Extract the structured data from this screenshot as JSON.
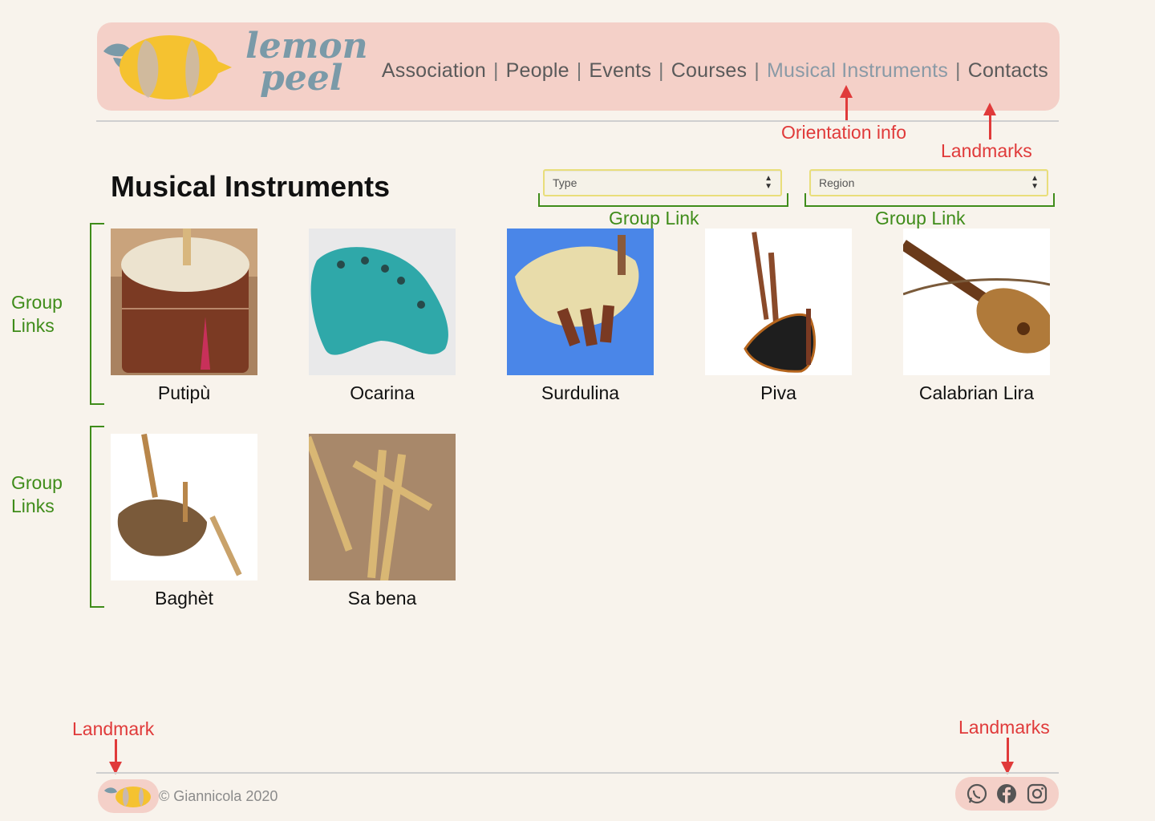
{
  "brand": {
    "logo_line1": "lemon",
    "logo_line2": "peel"
  },
  "nav": [
    {
      "label": "Association",
      "active": false
    },
    {
      "label": "People",
      "active": false
    },
    {
      "label": "Events",
      "active": false
    },
    {
      "label": "Courses",
      "active": false
    },
    {
      "label": "Musical Instruments",
      "active": true
    },
    {
      "label": "Contacts",
      "active": false
    }
  ],
  "nav_separator": "|",
  "page": {
    "title": "Musical Instruments"
  },
  "filters": {
    "type_placeholder": "Type",
    "region_placeholder": "Region"
  },
  "instruments": [
    {
      "name": "Putipù",
      "icon": "frame-drum-image"
    },
    {
      "name": "Ocarina",
      "icon": "ocarina-image"
    },
    {
      "name": "Surdulina",
      "icon": "bagpipe-image"
    },
    {
      "name": "Piva",
      "icon": "bagpipe-image"
    },
    {
      "name": "Calabrian Lira",
      "icon": "lira-image"
    },
    {
      "name": "Baghèt",
      "icon": "bagpipe-image"
    },
    {
      "name": "Sa bena",
      "icon": "reed-pipes-image"
    }
  ],
  "footer": {
    "copyright": "© Giannicola 2020",
    "social": [
      "whatsapp-icon",
      "facebook-icon",
      "instagram-icon"
    ]
  },
  "annotations": {
    "orientation": "Orientation info",
    "landmarks_top": "Landmarks",
    "group_link_type": "Group Link",
    "group_link_region": "Group Link",
    "group_links_row1_a": "Group",
    "group_links_row1_b": "Links",
    "group_links_row2_a": "Group",
    "group_links_row2_b": "Links",
    "landmark_footer": "Landmark",
    "landmarks_footer": "Landmarks"
  },
  "colors": {
    "background": "#f8f3ec",
    "header": "#f4d0c8",
    "annotation_red": "#e03a3a",
    "annotation_green": "#3f8c1a",
    "accent_yellow": "#f5c230",
    "logo_blue": "#7a9aa8"
  }
}
